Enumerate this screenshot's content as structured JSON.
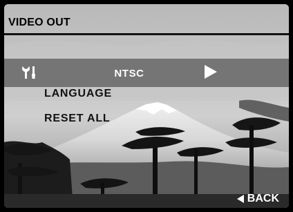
{
  "header": {
    "title": "VIDEO OUT"
  },
  "menu": {
    "selected": {
      "icon": "wrench-screwdriver-icon",
      "value": "NTSC",
      "arrow_icon": "right-arrow-icon"
    },
    "items": [
      {
        "label": "LANGUAGE"
      },
      {
        "label": "RESET ALL"
      }
    ]
  },
  "footer": {
    "back_label": "BACK",
    "back_icon": "left-arrow-icon"
  },
  "background": {
    "scene": "mountain-and-pine-trees-photo"
  },
  "colors": {
    "highlight": "#6e6e6e",
    "sky": "#c8c8c8",
    "text_dark": "#111111",
    "text_light": "#ffffff"
  }
}
